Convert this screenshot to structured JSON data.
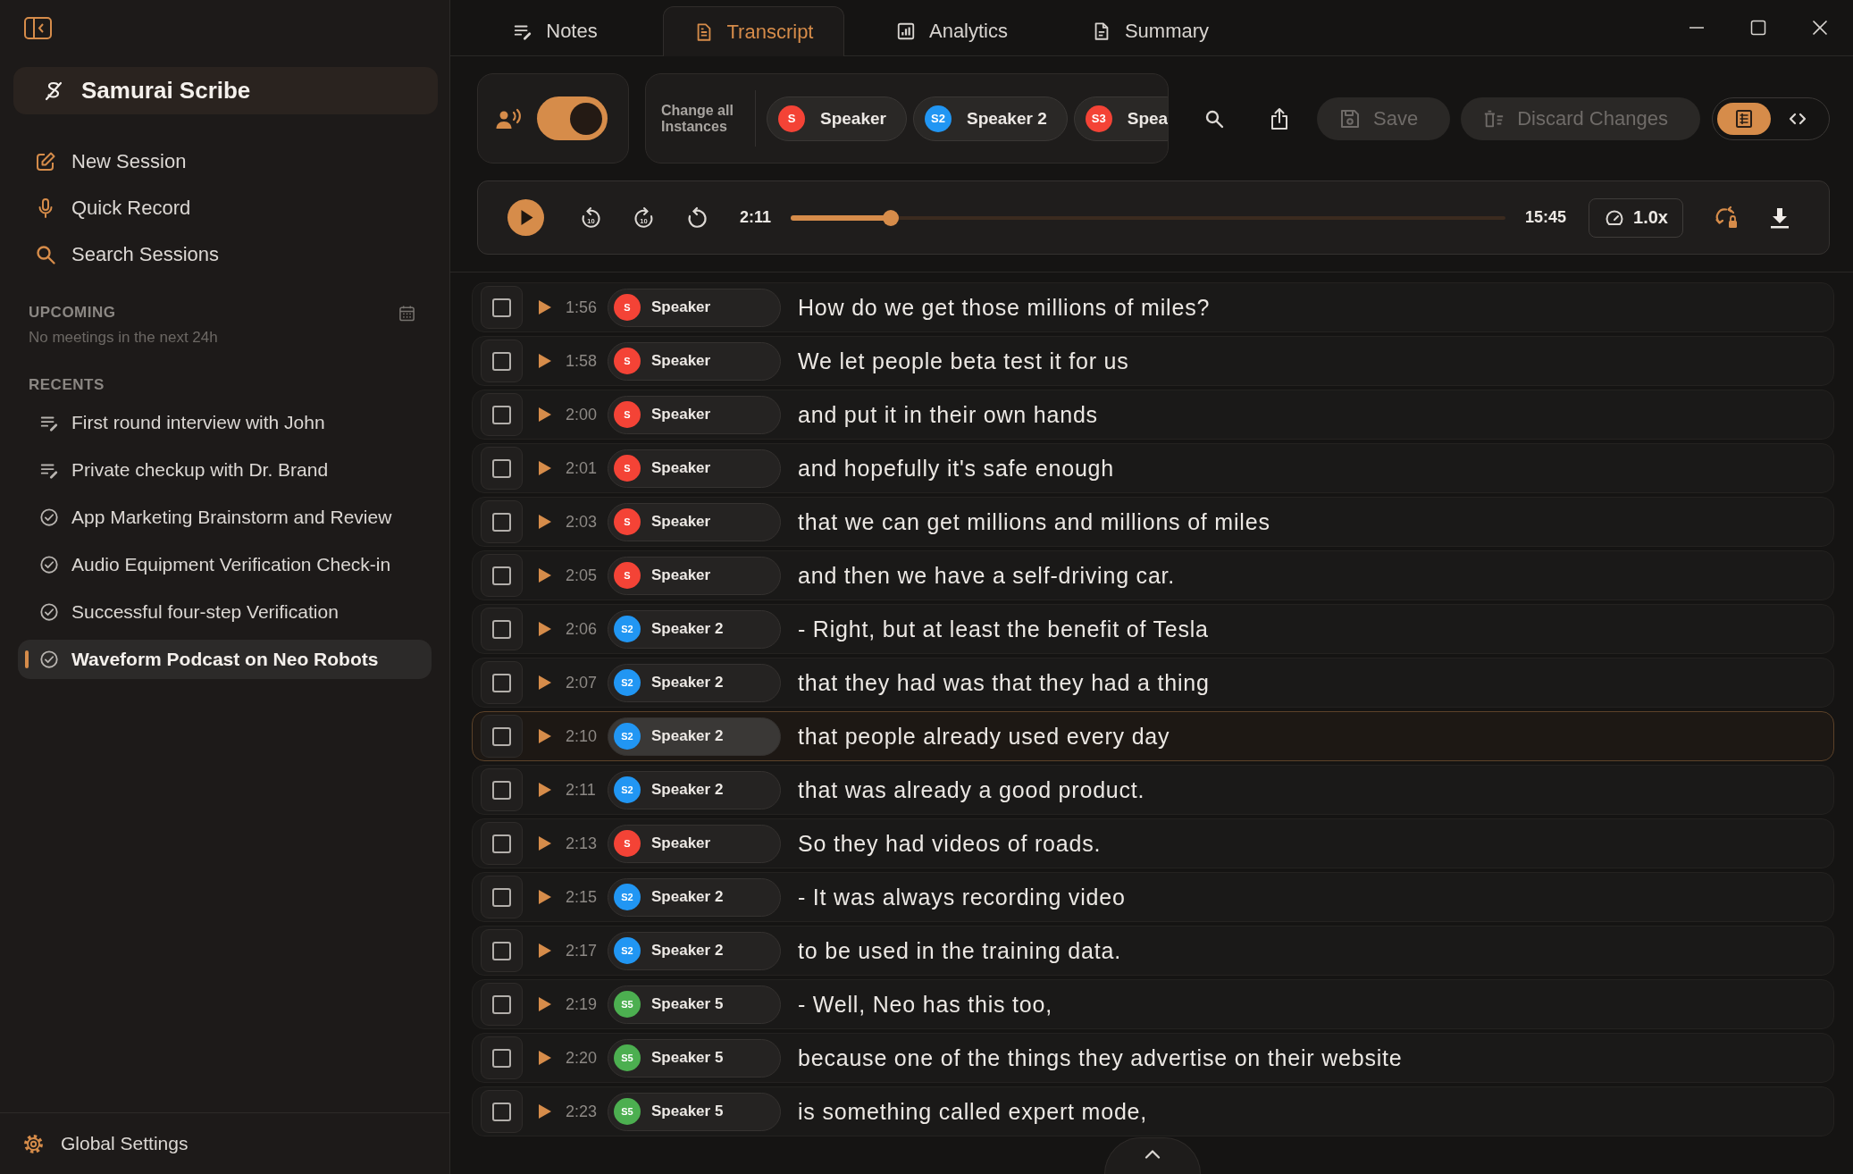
{
  "sidebar": {
    "brand": "Samurai Scribe",
    "nav": [
      {
        "label": "New Session"
      },
      {
        "label": "Quick Record"
      },
      {
        "label": "Search Sessions"
      }
    ],
    "upcoming": {
      "heading": "UPCOMING",
      "message": "No meetings in the next 24h"
    },
    "recents": {
      "heading": "RECENTS",
      "items": [
        {
          "label": "First round interview with John",
          "kind": "notes",
          "selected": false
        },
        {
          "label": "Private checkup with Dr. Brand",
          "kind": "notes",
          "selected": false
        },
        {
          "label": "App Marketing Brainstorm and Review",
          "kind": "completed",
          "selected": false
        },
        {
          "label": "Audio Equipment Verification Check-in",
          "kind": "completed",
          "selected": false
        },
        {
          "label": "Successful four-step Verification",
          "kind": "completed",
          "selected": false
        },
        {
          "label": "Waveform Podcast on Neo Robots",
          "kind": "completed",
          "selected": true
        }
      ]
    },
    "footer": {
      "label": "Global Settings"
    }
  },
  "tabs": [
    {
      "label": "Notes",
      "selected": false
    },
    {
      "label": "Transcript",
      "selected": true
    },
    {
      "label": "Analytics",
      "selected": false
    },
    {
      "label": "Summary",
      "selected": false
    }
  ],
  "toolbar": {
    "speaker_toggle": {
      "on": true
    },
    "change_all_label": "Change all Instances",
    "speakers": [
      {
        "badge": "S",
        "name": "Speaker",
        "color": "#f44336"
      },
      {
        "badge": "S2",
        "name": "Speaker 2",
        "color": "#2196f3"
      },
      {
        "badge": "S3",
        "name": "Spea",
        "color": "#f44336"
      }
    ],
    "save": {
      "label": "Save",
      "disabled": true
    },
    "discard": {
      "label": "Discard Changes",
      "disabled": true
    },
    "view_modes": [
      {
        "kind": "rich",
        "selected": true
      },
      {
        "kind": "source",
        "selected": false
      }
    ]
  },
  "player": {
    "skip_back": "10",
    "skip_forward": "10",
    "current_time": "2:11",
    "position": {
      "level": 0.14
    },
    "duration": "15:45",
    "speed": "1.0x"
  },
  "rows": [
    {
      "time": "1:56",
      "badge": "S",
      "speaker": "Speaker",
      "color": "#f44336",
      "text": "How do we get those millions of miles?",
      "checked": false,
      "selected": false
    },
    {
      "time": "1:58",
      "badge": "S",
      "speaker": "Speaker",
      "color": "#f44336",
      "text": "We let people beta test it for us",
      "checked": false,
      "selected": false
    },
    {
      "time": "2:00",
      "badge": "S",
      "speaker": "Speaker",
      "color": "#f44336",
      "text": "and put it in their own hands",
      "checked": false,
      "selected": false
    },
    {
      "time": "2:01",
      "badge": "S",
      "speaker": "Speaker",
      "color": "#f44336",
      "text": "and hopefully it's safe enough",
      "checked": false,
      "selected": false
    },
    {
      "time": "2:03",
      "badge": "S",
      "speaker": "Speaker",
      "color": "#f44336",
      "text": "that we can get millions and millions of miles",
      "checked": false,
      "selected": false
    },
    {
      "time": "2:05",
      "badge": "S",
      "speaker": "Speaker",
      "color": "#f44336",
      "text": "and then we have a self-driving car.",
      "checked": false,
      "selected": false
    },
    {
      "time": "2:06",
      "badge": "S2",
      "speaker": "Speaker 2",
      "color": "#2196f3",
      "text": "- Right, but at least the benefit of Tesla",
      "checked": false,
      "selected": false
    },
    {
      "time": "2:07",
      "badge": "S2",
      "speaker": "Speaker 2",
      "color": "#2196f3",
      "text": "that they had was that they had a thing",
      "checked": false,
      "selected": false
    },
    {
      "time": "2:10",
      "badge": "S2",
      "speaker": "Speaker 2",
      "color": "#2196f3",
      "text": "that people already used every day",
      "checked": false,
      "selected": true
    },
    {
      "time": "2:11",
      "badge": "S2",
      "speaker": "Speaker 2",
      "color": "#2196f3",
      "text": "that was already a good product.",
      "checked": false,
      "selected": false
    },
    {
      "time": "2:13",
      "badge": "S",
      "speaker": "Speaker",
      "color": "#f44336",
      "text": "So they had videos of roads.",
      "checked": false,
      "selected": false
    },
    {
      "time": "2:15",
      "badge": "S2",
      "speaker": "Speaker 2",
      "color": "#2196f3",
      "text": "- It was always recording video",
      "checked": false,
      "selected": false
    },
    {
      "time": "2:17",
      "badge": "S2",
      "speaker": "Speaker 2",
      "color": "#2196f3",
      "text": "to be used in the training data.",
      "checked": false,
      "selected": false
    },
    {
      "time": "2:19",
      "badge": "S5",
      "speaker": "Speaker 5",
      "color": "#4caf50",
      "text": "- Well, Neo has this too,",
      "checked": false,
      "selected": false
    },
    {
      "time": "2:20",
      "badge": "S5",
      "speaker": "Speaker 5",
      "color": "#4caf50",
      "text": "because one of the things they advertise on their website",
      "checked": false,
      "selected": false
    },
    {
      "time": "2:23",
      "badge": "S5",
      "speaker": "Speaker 5",
      "color": "#4caf50",
      "text": "is something called expert mode,",
      "checked": false,
      "selected": false
    }
  ]
}
